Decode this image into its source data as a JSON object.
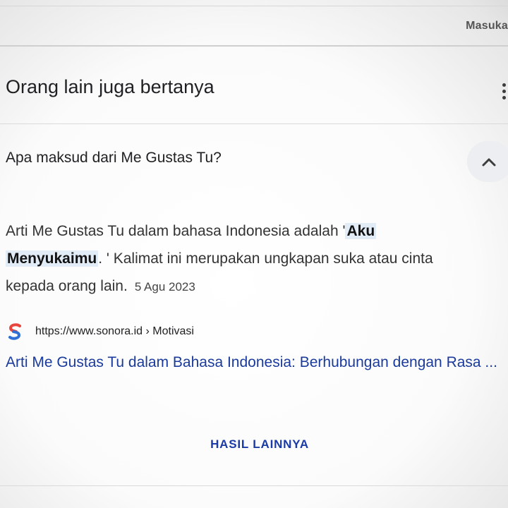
{
  "header": {
    "sign_in_label": "Masuka"
  },
  "people_also_ask": {
    "title": "Orang lain juga bertanya",
    "menu_icon": "more-vert-icon",
    "question": "Apa maksud dari Me Gustas Tu?",
    "collapse_icon": "chevron-up-icon",
    "answer": {
      "line1_prefix": "Arti Me Gustas Tu dalam bahasa Indonesia adalah '",
      "highlight_part1": "Aku",
      "highlight_part2": "Menyukaimu",
      "line2_suffix": ". ' Kalimat ini merupakan ungkapan suka atau cinta",
      "line3": "kepada orang lain.",
      "date": "5 Agu 2023"
    },
    "source": {
      "favicon_icon": "sonora-logo-icon",
      "url": "https://www.sonora.id › Motivasi"
    },
    "result_title": "Arti Me Gustas Tu dalam Bahasa Indonesia: Berhubungan dengan Rasa ...",
    "more_results_label": "HASIL LAINNYA"
  },
  "colors": {
    "link": "#1a3a9c",
    "highlight_bg": "#e1ecf7",
    "favicon_red": "#e8453c",
    "favicon_blue": "#2f6fd6"
  }
}
